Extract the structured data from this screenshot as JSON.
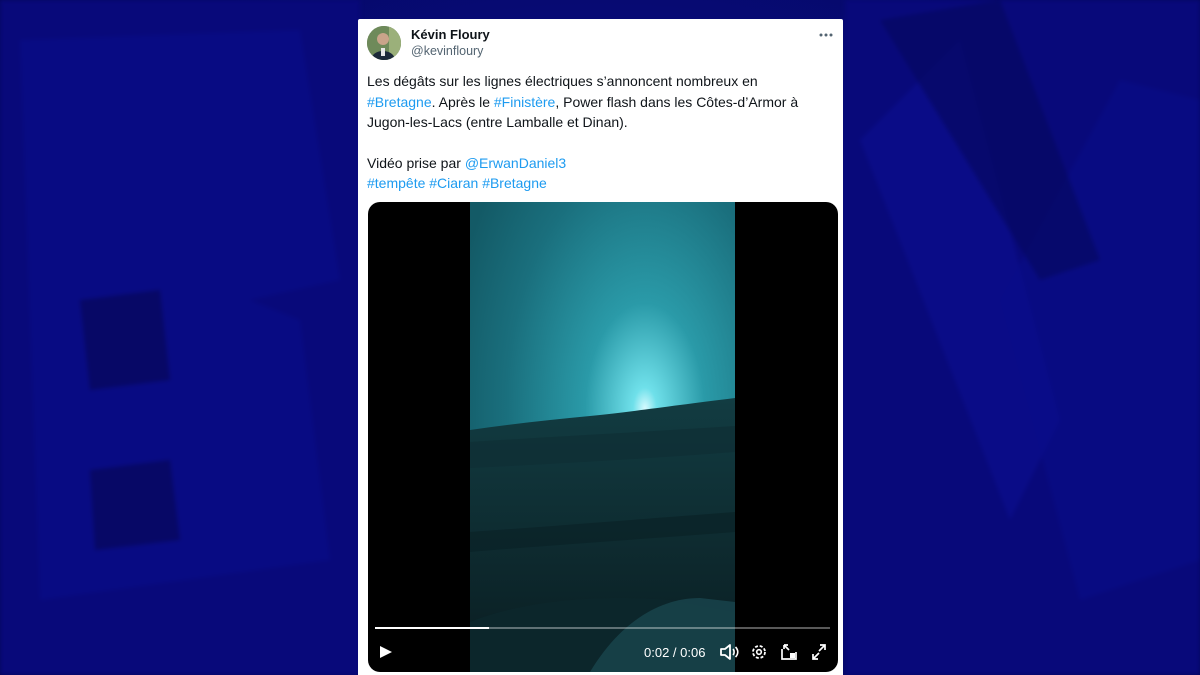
{
  "tweet": {
    "author_name": "Kévin Floury",
    "author_handle": "@kevinfloury",
    "text": {
      "line1": "Les dégâts sur les lignes électriques s’annoncent nombreux en",
      "hashtag_bretagne": "#Bretagne",
      "after_bretagne": ". Après le ",
      "hashtag_finistere": "#Finistère",
      "after_finistere": ", Power flash dans les Côtes-d’Armor à",
      "line3": "Jugon-les-Lacs (entre Lamballe et Dinan).",
      "credit_prefix": "Vidéo prise par ",
      "credit_mention": "@ErwanDaniel3",
      "hashtag_tempete": "#tempête",
      "hashtag_ciaran": "#Ciaran",
      "hashtag_bretagne_2": "#Bretagne"
    }
  },
  "video_player": {
    "current_time": "0:02",
    "separator": " / ",
    "duration": "0:06",
    "progress_fraction": 0.25,
    "icons": {
      "play": "play-icon",
      "volume": "volume-icon",
      "settings": "settings-gear-icon",
      "pip": "picture-in-picture-icon",
      "fullscreen": "fullscreen-icon"
    }
  },
  "colors": {
    "link": "#1d9bf0",
    "text": "#0f1419",
    "secondary_text": "#536471",
    "background": "#06086a",
    "video_background": "#000000"
  }
}
